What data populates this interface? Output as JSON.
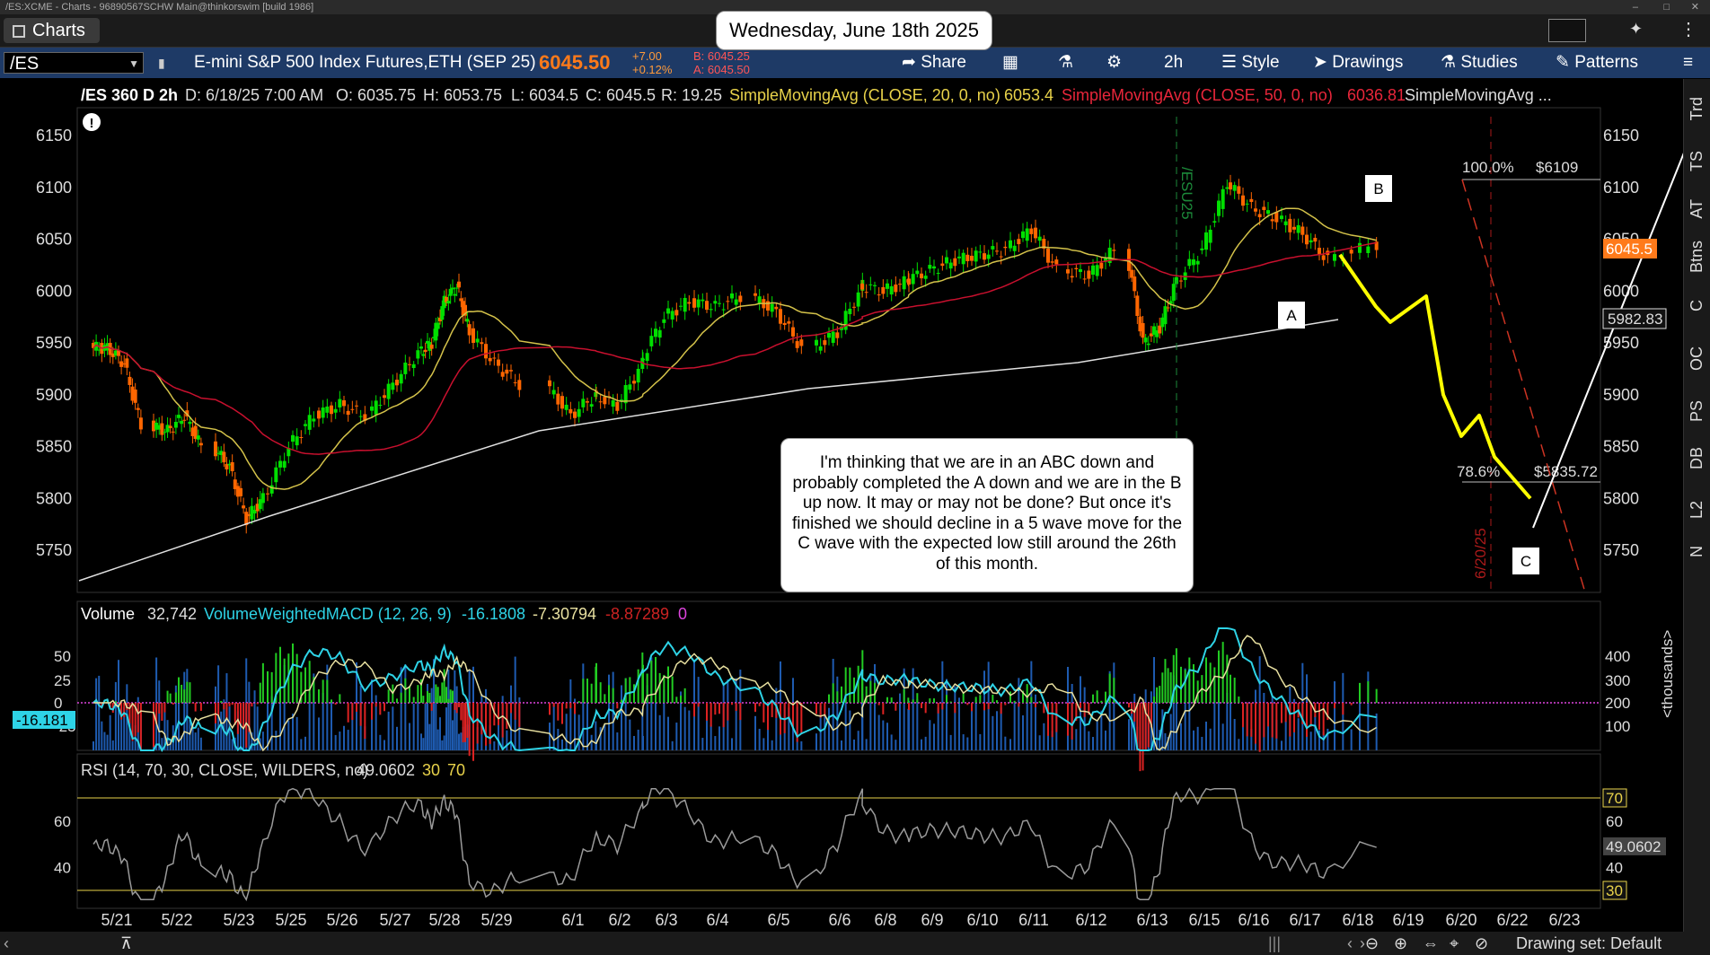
{
  "window": {
    "title": "/ES:XCME - Charts - 96890567SCHW Main@thinkorswim [build 1986]",
    "tab_label": "Charts"
  },
  "date_banner": "Wednesday, June 18th 2025",
  "toolbar": {
    "symbol": "/ES",
    "description": "E-mini S&P 500 Index Futures,ETH (SEP 25)",
    "last": "6045.50",
    "change": "+7.00",
    "change_pct": "+0.12%",
    "bid": "B: 6045.25",
    "ask": "A: 6045.50",
    "share_label": "Share",
    "timeframe": "2h",
    "style_label": "Style",
    "drawings_label": "Drawings",
    "studies_label": "Studies",
    "patterns_label": "Patterns"
  },
  "header_line": {
    "symbol": "/ES 360 D 2h",
    "bar": "D: 6/18/25 7:00 AM",
    "open": "O: 6035.75",
    "high": "H: 6053.75",
    "low": "L: 6034.5",
    "close": "C: 6045.5",
    "range": "R: 19.25",
    "sma20_label": "SimpleMovingAvg (CLOSE, 20, 0, no)",
    "sma20_value": "6053.4",
    "sma50_label": "SimpleMovingAvg (CLOSE, 50, 0, no)",
    "sma50_value": "6036.81",
    "sma200_label": "SimpleMovingAvg ..."
  },
  "colors": {
    "up": "#00e000",
    "down": "#ff6600",
    "sma20": "#d4c24a",
    "sma50": "#c8102e",
    "sma200": "#e0e0e0",
    "projection": "#ffff00",
    "fib": "#cc3322"
  },
  "price_axis": {
    "ticks": [
      "6150",
      "6100",
      "6050",
      "6000",
      "5950",
      "5900",
      "5850",
      "5800",
      "5750"
    ],
    "current_label": "6045.5",
    "other_label": "5982.83"
  },
  "wave_labels": [
    "A",
    "B",
    "C"
  ],
  "fib": {
    "level_100": "100.0%",
    "price_100": "$6109",
    "level_786": "78.6%",
    "price_786": "$5835.72"
  },
  "expiration_markers": [
    "/ESU25",
    "6/20/25"
  ],
  "annotation": "I'm thinking that we are in an ABC down and probably completed the A down and we are in the B up now.  It may or may not be done?  But once it's finished we should decline in a 5 wave move for the C wave with the expected low still around the 26th of this month.",
  "volume_panel": {
    "vol_label": "Volume",
    "vol_value": "32,742",
    "macd_label": "VolumeWeightedMACD (12, 26, 9)",
    "macd_value": "-16.1808",
    "signal_value": "-7.30794",
    "diff_value": "-8.87289",
    "zero_value": "0",
    "left_ticks": [
      "50",
      "25",
      "0",
      "-25"
    ],
    "right_ticks": [
      "400",
      "300",
      "200",
      "100"
    ],
    "right_axis_label": "<thousands>",
    "current_label": "-16.181"
  },
  "rsi_panel": {
    "label": "RSI (14, 70, 30, CLOSE, WILDERS, no)",
    "value": "49.0602",
    "os": "30",
    "ob": "70",
    "left_ticks": [
      "60",
      "40"
    ],
    "right_ticks": [
      "70",
      "60",
      "49.0602",
      "40",
      "30"
    ]
  },
  "x_axis": [
    "5/21",
    "5/22",
    "5/23",
    "5/25",
    "5/26",
    "5/27",
    "5/28",
    "5/29",
    "6/1",
    "6/2",
    "6/3",
    "6/4",
    "6/5",
    "6/6",
    "6/8",
    "6/9",
    "6/10",
    "6/11",
    "6/12",
    "6/13",
    "6/15",
    "6/16",
    "6/17",
    "6/18",
    "6/19",
    "6/20",
    "6/22",
    "6/23"
  ],
  "sidebar_tabs": [
    "Trd",
    "TS",
    "AT",
    "Btns",
    "C",
    "OC",
    "PS",
    "DB",
    "L2",
    "N"
  ],
  "status_bar": {
    "drawing_set": "Drawing set: Default"
  },
  "chart_data": {
    "type": "candlestick",
    "title": "/ES 360 D 2h",
    "ylim": [
      5730,
      6170
    ],
    "series": [
      {
        "name": "SimpleMovingAvg (CLOSE, 20, 0, no)",
        "last": 6053.4
      },
      {
        "name": "SimpleMovingAvg (CLOSE, 50, 0, no)",
        "last": 6036.81
      }
    ],
    "ohlc_last": {
      "open": 6035.75,
      "high": 6053.75,
      "low": 6034.5,
      "close": 6045.5
    },
    "price_path": [
      [
        "5/21",
        5945
      ],
      [
        "5/21",
        5930
      ],
      [
        "5/21",
        5870
      ],
      [
        "5/22",
        5865
      ],
      [
        "5/22",
        5880
      ],
      [
        "5/22",
        5850
      ],
      [
        "5/23",
        5830
      ],
      [
        "5/23",
        5780
      ],
      [
        "5/23",
        5800
      ],
      [
        "5/25",
        5850
      ],
      [
        "5/25",
        5880
      ],
      [
        "5/26",
        5890
      ],
      [
        "5/26",
        5880
      ],
      [
        "5/27",
        5910
      ],
      [
        "5/27",
        5940
      ],
      [
        "5/28",
        5950
      ],
      [
        "5/28",
        5990
      ],
      [
        "5/28",
        6005
      ],
      [
        "5/28",
        5960
      ],
      [
        "5/29",
        5930
      ],
      [
        "5/29",
        5910
      ],
      [
        "6/1",
        5880
      ],
      [
        "6/1",
        5900
      ],
      [
        "6/2",
        5890
      ],
      [
        "6/2",
        5930
      ],
      [
        "6/3",
        5975
      ],
      [
        "6/3",
        5990
      ],
      [
        "6/4",
        5985
      ],
      [
        "6/4",
        5995
      ],
      [
        "6/5",
        5980
      ],
      [
        "6/5",
        5945
      ],
      [
        "6/6",
        5960
      ],
      [
        "6/6",
        6005
      ],
      [
        "6/8",
        6000
      ],
      [
        "6/8",
        6010
      ],
      [
        "6/9",
        6020
      ],
      [
        "6/9",
        6030
      ],
      [
        "6/10",
        6035
      ],
      [
        "6/10",
        6040
      ],
      [
        "6/11",
        6060
      ],
      [
        "6/11",
        6020
      ],
      [
        "6/12",
        6015
      ],
      [
        "6/12",
        6040
      ],
      [
        "6/13",
        5950
      ],
      [
        "6/13",
        5965
      ],
      [
        "6/13",
        6010
      ],
      [
        "6/15",
        6040
      ],
      [
        "6/15",
        6105
      ],
      [
        "6/16",
        6080
      ],
      [
        "6/16",
        6070
      ],
      [
        "6/17",
        6055
      ],
      [
        "6/17",
        6030
      ],
      [
        "6/18",
        6045.5
      ]
    ],
    "projection": [
      [
        "6/18",
        6035
      ],
      [
        "6/18",
        5985
      ],
      [
        "6/19",
        5970
      ],
      [
        "6/19",
        5995
      ],
      [
        "6/20",
        5900
      ],
      [
        "6/20",
        5860
      ],
      [
        "6/20",
        5880
      ],
      [
        "6/22",
        5840
      ],
      [
        "6/22",
        5800
      ]
    ],
    "volume_panel_ylim": [
      -40,
      60
    ],
    "rsi_ylim": [
      20,
      80
    ],
    "rsi_last": 49.0602
  }
}
